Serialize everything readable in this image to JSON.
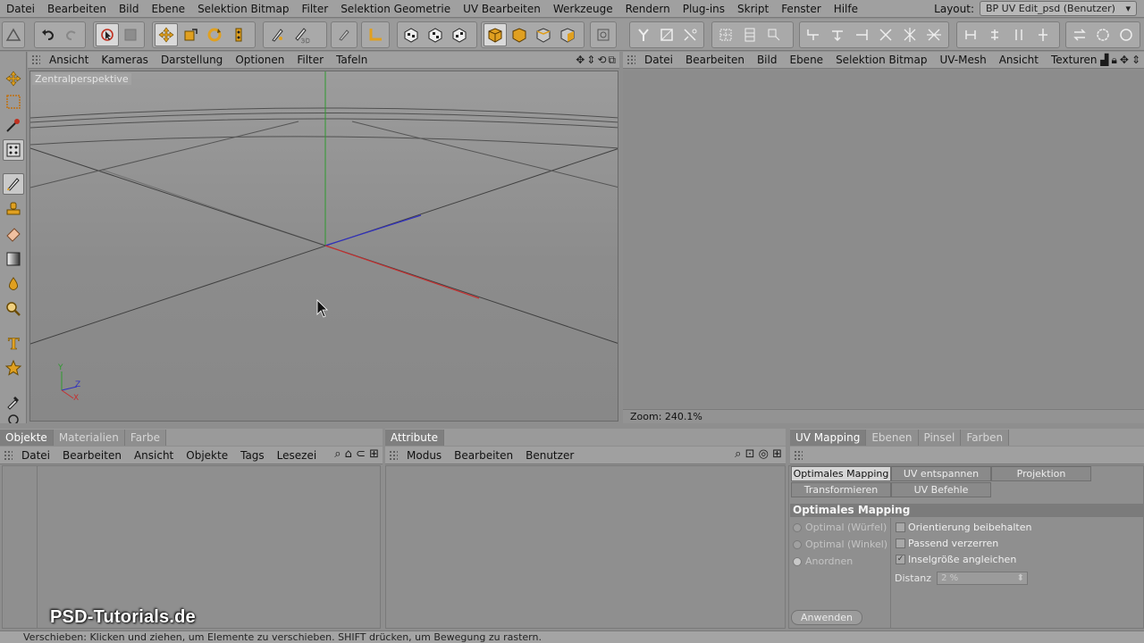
{
  "menubar": {
    "items": [
      "Datei",
      "Bearbeiten",
      "Bild",
      "Ebene",
      "Selektion Bitmap",
      "Filter",
      "Selektion Geometrie",
      "UV Bearbeiten",
      "Werkzeuge",
      "Rendern",
      "Plug-ins",
      "Skript",
      "Fenster",
      "Hilfe"
    ],
    "layout_label": "Layout:",
    "layout_value": "BP UV Edit_psd (Benutzer)"
  },
  "viewport": {
    "menu": [
      "Ansicht",
      "Kameras",
      "Darstellung",
      "Optionen",
      "Filter",
      "Tafeln"
    ],
    "label": "Zentralperspektive",
    "axis_y": "Y",
    "axis_z": "Z",
    "axis_x": "X"
  },
  "uv_editor": {
    "menu": [
      "Datei",
      "Bearbeiten",
      "Bild",
      "Ebene",
      "Selektion Bitmap",
      "UV-Mesh",
      "Ansicht",
      "Texturen"
    ],
    "zoom": "Zoom: 240.1%"
  },
  "objects_panel": {
    "tabs": [
      "Objekte",
      "Materialien",
      "Farbe"
    ],
    "menu": [
      "Datei",
      "Bearbeiten",
      "Ansicht",
      "Objekte",
      "Tags",
      "Lesezei"
    ]
  },
  "attributes_panel": {
    "tabs": [
      "Attribute"
    ],
    "menu": [
      "Modus",
      "Bearbeiten",
      "Benutzer"
    ]
  },
  "uv_panel": {
    "tabs": [
      "UV Mapping",
      "Ebenen",
      "Pinsel",
      "Farben"
    ],
    "buttons_row1": [
      "Optimales Mapping",
      "UV entspannen",
      "Projektion"
    ],
    "buttons_row2": [
      "Transformieren",
      "UV Befehle"
    ],
    "section_title": "Optimales Mapping",
    "radios": [
      "Optimal (Würfel)",
      "Optimal (Winkel)",
      "Anordnen"
    ],
    "checks": [
      {
        "label": "Orientierung beibehalten",
        "checked": false
      },
      {
        "label": "Passend verzerren",
        "checked": false
      },
      {
        "label": "Inselgröße angleichen",
        "checked": true
      }
    ],
    "distanz_label": "Distanz",
    "distanz_value": "2 %",
    "apply": "Anwenden"
  },
  "statusbar": {
    "text": "Verschieben: Klicken und ziehen, um Elemente zu verschieben. SHIFT drücken, um Bewegung zu rastern."
  },
  "watermark": "PSD-Tutorials.de",
  "colors": {
    "accent_orange": "#e0a020",
    "axis_green": "#2f9a2f",
    "axis_red": "#c53030",
    "axis_blue": "#3030c0"
  }
}
